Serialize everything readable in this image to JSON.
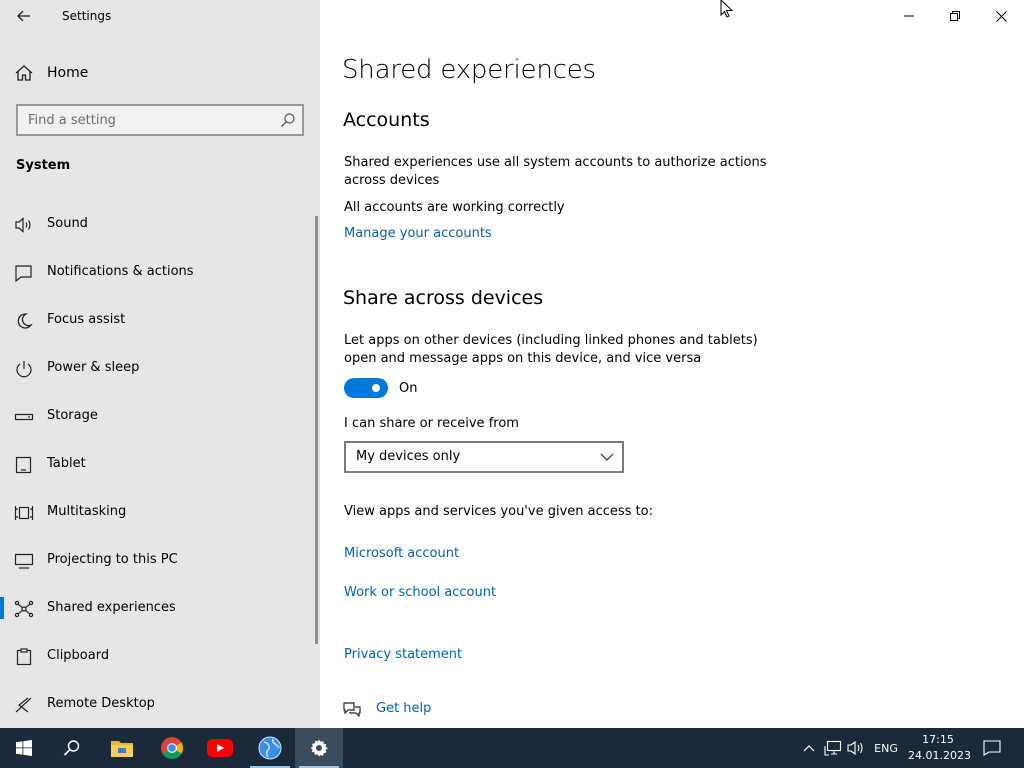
{
  "window": {
    "app_title": "Settings",
    "controls": {
      "minimize": "minimize",
      "maximize": "restore",
      "close": "close"
    }
  },
  "sidebar": {
    "home_label": "Home",
    "search_placeholder": "Find a setting",
    "section": "System",
    "items": [
      {
        "label": "Sound",
        "icon": "speaker-icon"
      },
      {
        "label": "Notifications & actions",
        "icon": "notification-icon"
      },
      {
        "label": "Focus assist",
        "icon": "moon-icon"
      },
      {
        "label": "Power & sleep",
        "icon": "power-icon"
      },
      {
        "label": "Storage",
        "icon": "storage-icon"
      },
      {
        "label": "Tablet",
        "icon": "tablet-icon"
      },
      {
        "label": "Multitasking",
        "icon": "multitasking-icon"
      },
      {
        "label": "Projecting to this PC",
        "icon": "projecting-icon"
      },
      {
        "label": "Shared experiences",
        "icon": "shared-experiences-icon",
        "active": true
      },
      {
        "label": "Clipboard",
        "icon": "clipboard-icon"
      },
      {
        "label": "Remote Desktop",
        "icon": "remote-desktop-icon"
      }
    ]
  },
  "main": {
    "title": "Shared experiences",
    "accounts": {
      "heading": "Accounts",
      "description": "Shared experiences use all system accounts to authorize actions across devices",
      "status": "All accounts are working correctly",
      "link": "Manage your accounts"
    },
    "share": {
      "heading": "Share across devices",
      "description": "Let apps on other devices (including linked phones and tablets) open and message apps on this device, and vice versa",
      "toggle_label": "On",
      "toggle_on": true,
      "dropdown_label": "I can share or receive from",
      "dropdown_value": "My devices only",
      "access_text": "View apps and services you've given access to:",
      "links": [
        "Microsoft account",
        "Work or school account"
      ]
    },
    "privacy_link": "Privacy statement",
    "help_link": "Get help"
  },
  "taskbar": {
    "apps": [
      "start-icon",
      "search-icon",
      "file-explorer-icon",
      "chrome-icon",
      "youtube-icon",
      "globe-icon",
      "settings-icon"
    ],
    "tray": {
      "language": "ENG",
      "time": "17:15",
      "date": "24.01.2023"
    }
  },
  "colors": {
    "accent": "#0078d7",
    "link": "#0063b1",
    "sidebar_bg": "#e6e6e6",
    "taskbar_bg": "#1b2a3a"
  }
}
